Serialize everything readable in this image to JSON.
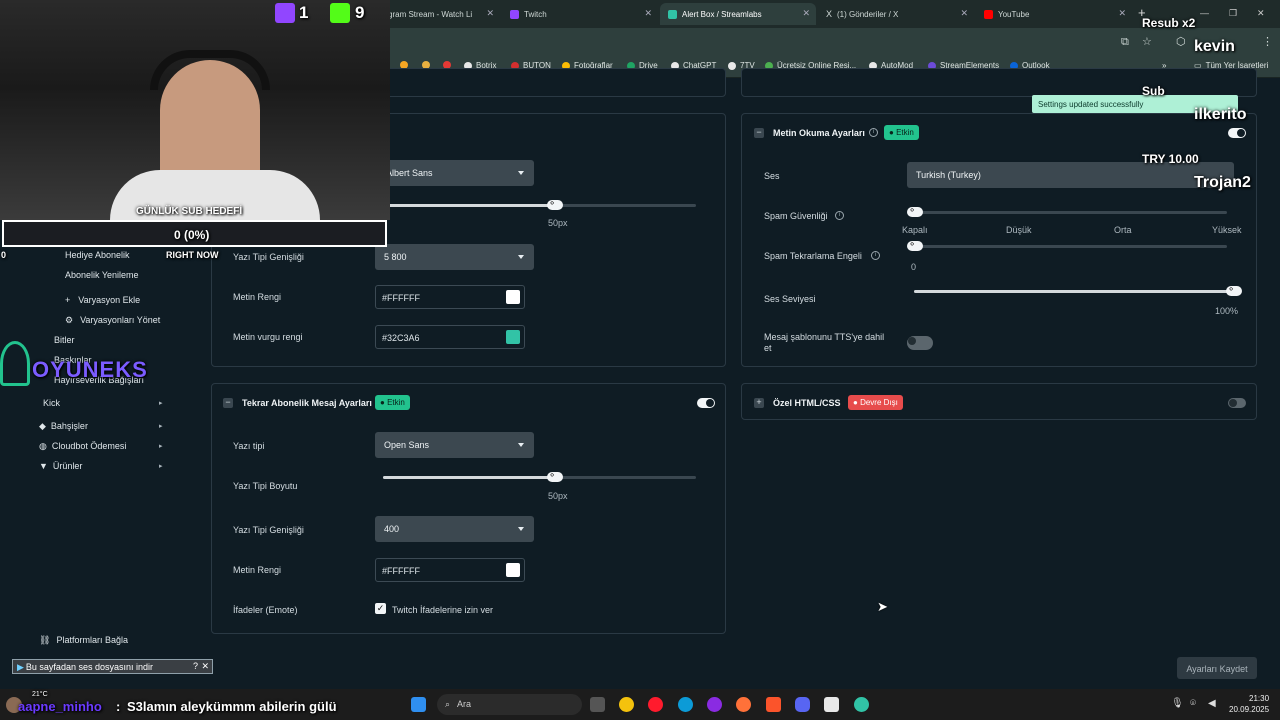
{
  "browser": {
    "tabs": [
      {
        "label": "gram Stream - Watch Li",
        "favicon_color": "#e9e9e9"
      },
      {
        "label": "Twitch",
        "favicon_color": "#9146ff"
      },
      {
        "label": "Alert Box / Streamlabs",
        "favicon_color": "#31c3a6"
      },
      {
        "label": "(1) Gönderiler / X",
        "favicon_color": "#ffffff"
      },
      {
        "label": "YouTube",
        "favicon_color": "#ff0000"
      }
    ],
    "new_tab": "+",
    "bookmarks": [
      {
        "label": "Botrix",
        "color": "#e8e8e8"
      },
      {
        "label": "BUTON",
        "color": "#d32f2f"
      },
      {
        "label": "Fotoğraflar",
        "color": "#fbbc04"
      },
      {
        "label": "Drive",
        "color": "#1fa463"
      },
      {
        "label": "ChatGPT",
        "color": "#e8e8e8"
      },
      {
        "label": "7TV",
        "color": "#e8e8e8"
      },
      {
        "label": "Ücretsiz Online Resi...",
        "color": "#4caf50"
      },
      {
        "label": "AutoMod",
        "color": "#e8e8e8"
      },
      {
        "label": "StreamElements",
        "color": "#6c4bd8"
      },
      {
        "label": "Outlook",
        "color": "#0a64d8"
      }
    ],
    "bookmarks_all": "Tüm Yer İşaretleri"
  },
  "overlay": {
    "twitch_count": "1",
    "kick_count": "9",
    "goal_title": "GÜNLÜK SUB HEDEFİ",
    "goal_value": "0 (0%)",
    "goal_left": "0",
    "goal_right": "RIGHT NOW",
    "goal_progress": 0,
    "alerts": [
      "Resub x2",
      "kevin",
      "Sub",
      "ilkerito",
      "TRY 10.00",
      "Trojan2"
    ],
    "brand": "OYUNEKS",
    "chat_user": "aapne_minho",
    "chat_message": "S3lamın aleykümmm abilerin gülü"
  },
  "sidebar": {
    "items": [
      {
        "label": "Hediye Abonelik"
      },
      {
        "label": "Abonelik Yenileme"
      },
      {
        "label": "Varyasyon Ekle"
      },
      {
        "label": "Varyasyonları Yönet"
      },
      {
        "label": "Bitler"
      },
      {
        "label": "Baskınlar"
      },
      {
        "label": "Hayırseverlik Bağışları"
      },
      {
        "label": "Kick"
      },
      {
        "label": "Bahşişler"
      },
      {
        "label": "Cloudbot Ödemesi"
      },
      {
        "label": "Ürünler"
      },
      {
        "label": "Platformları Bağla"
      }
    ],
    "download_banner": "Bu sayfadan ses dosyasını indir"
  },
  "left_top_card": {
    "font_value": "Albert Sans",
    "size_value": "50px",
    "size_percent": 55,
    "weight_label": "Yazı Tipi Genişliği",
    "weight_value": "5 800",
    "color_label": "Metin Rengi",
    "color_value": "#FFFFFF",
    "color_hex": "#FFFFFF",
    "highlight_label": "Metin vurgu rengi",
    "highlight_value": "#32C3A6",
    "highlight_hex": "#32C3A6"
  },
  "resub_card": {
    "title": "Tekrar Abonelik Mesaj Ayarları",
    "badge": "Etkin",
    "font_label": "Yazı tipi",
    "font_value": "Open Sans",
    "size_label": "Yazı Tipi Boyutu",
    "size_value": "50px",
    "size_percent": 55,
    "weight_label": "Yazı Tipi Genişliği",
    "weight_value": "400",
    "color_label": "Metin Rengi",
    "color_value": "#FFFFFF",
    "color_hex": "#FFFFFF",
    "emote_label": "İfadeler (Emote)",
    "emote_checkbox": "Twitch İfadelerine izin ver",
    "emote_checked": true
  },
  "tts_card": {
    "title": "Metin Okuma Ayarları",
    "badge": "Etkin",
    "voice_label": "Ses",
    "voice_value": "Turkish (Turkey)",
    "spam_label": "Spam Güvenliği",
    "spam_levels": [
      "Kapalı",
      "Düşük",
      "Orta",
      "Yüksek"
    ],
    "spam_level_index": 0,
    "repeat_label": "Spam Tekrarlama Engeli",
    "repeat_value": "0",
    "volume_label": "Ses Seviyesi",
    "volume_value": "100%",
    "volume_percent": 100,
    "include_label": "Mesaj şablonunu TTS'ye dahil et",
    "include_on": false
  },
  "custom_card": {
    "title": "Özel HTML/CSS",
    "badge": "Devre Dışı"
  },
  "toast": "Settings updated successfully",
  "save_button": "Ayarları Kaydet",
  "taskbar": {
    "search": "Ara",
    "temperature": "21°C",
    "time": "21:30",
    "date": "20.09.2025"
  },
  "colors": {
    "accent": "#22c38e",
    "danger": "#e74c4c",
    "bg": "#0f1c24"
  }
}
